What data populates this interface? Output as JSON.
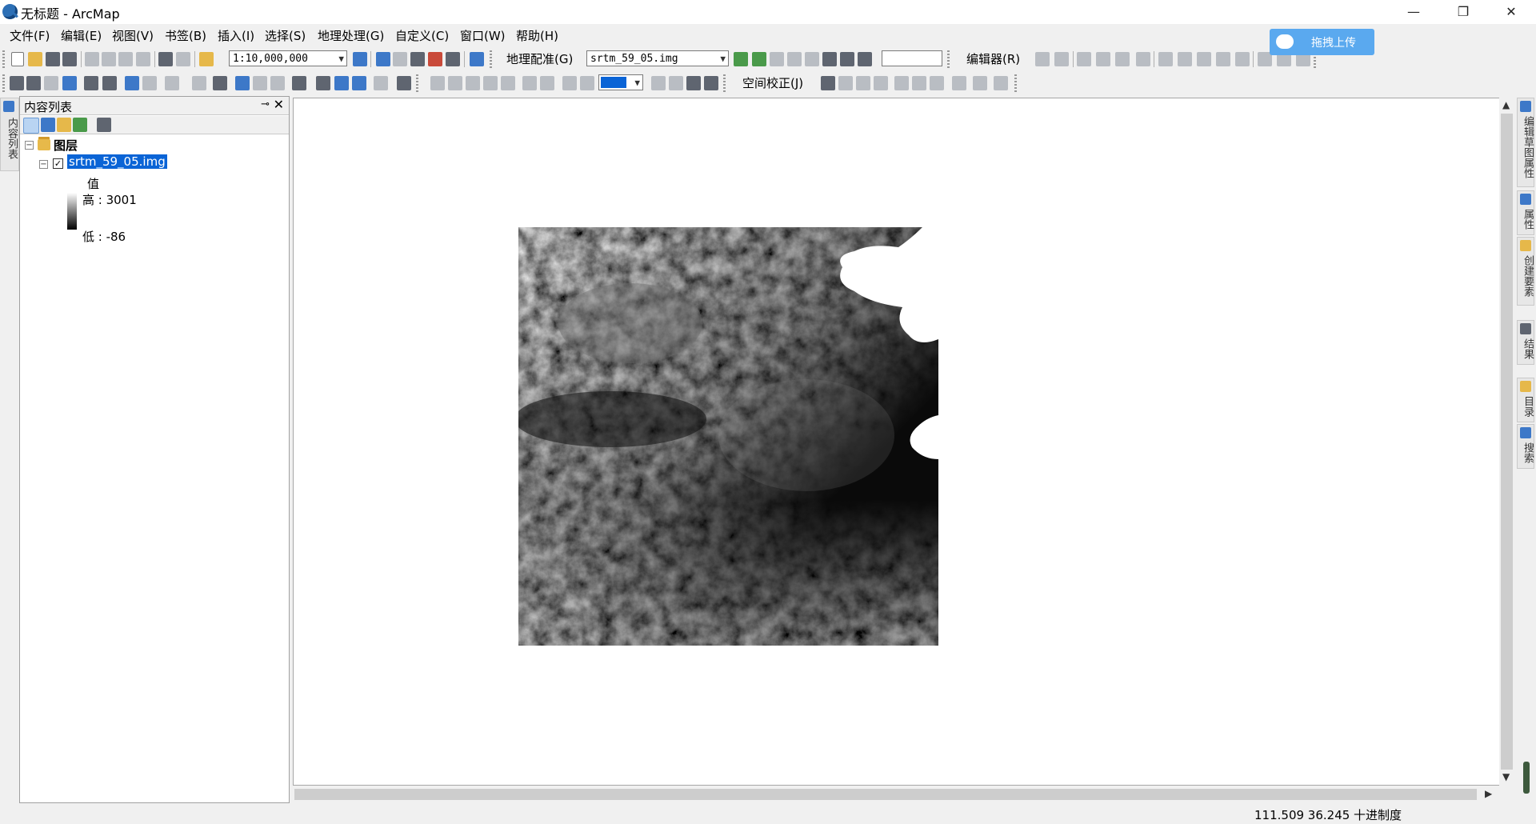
{
  "window": {
    "title": "无标题 - ArcMap"
  },
  "menu": [
    "文件(F)",
    "编辑(E)",
    "视图(V)",
    "书签(B)",
    "插入(I)",
    "选择(S)",
    "地理处理(G)",
    "自定义(C)",
    "窗口(W)",
    "帮助(H)"
  ],
  "toolbar1": {
    "scale": "1:10,000,000",
    "georef_label": "地理配准(G)",
    "layer_combo": "srtm_59_05.img",
    "editor_label": "编辑器(R)"
  },
  "toolbar2": {
    "spatial_adjust_label": "空间校正(J)"
  },
  "upload": {
    "label": "拖拽上传"
  },
  "left_strip": {
    "label": "内容列表"
  },
  "toc": {
    "title": "内容列表",
    "root": "图层",
    "layer": "srtm_59_05.img",
    "legend_heading": "值",
    "high": "高 : 3001",
    "low": "低 : -86"
  },
  "right_dock": [
    "编辑草图属性",
    "属性",
    "创建要素",
    "结果",
    "目录",
    "搜索"
  ],
  "status": {
    "coords": "111.509  36.245 十进制度"
  }
}
